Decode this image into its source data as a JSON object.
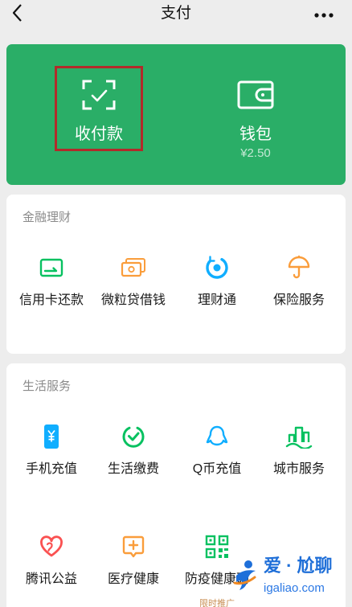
{
  "header": {
    "title": "支付",
    "back_icon": "chevron-left-icon",
    "more_icon": "more-dots-icon"
  },
  "theme": {
    "page_bg": "#ededed",
    "hero_green": "#2aae67",
    "highlight_red": "#b22a2a"
  },
  "hero": {
    "pay": {
      "label": "收付款",
      "icon": "scan-pay-icon"
    },
    "wallet": {
      "label": "钱包",
      "balance": "¥2.50",
      "icon": "wallet-icon"
    }
  },
  "finance": {
    "title": "金融理财",
    "items": [
      {
        "label": "信用卡还款",
        "icon": "credit-card-repay-icon",
        "color": "#07c160"
      },
      {
        "label": "微粒贷借钱",
        "icon": "loan-banknote-icon",
        "color": "#fa9d3b"
      },
      {
        "label": "理财通",
        "icon": "wealth-management-icon",
        "color": "#10aeff"
      },
      {
        "label": "保险服务",
        "icon": "insurance-umbrella-icon",
        "color": "#fa9d3b"
      }
    ]
  },
  "life": {
    "title": "生活服务",
    "items": [
      {
        "label": "手机充值",
        "icon": "mobile-topup-icon",
        "color": "#10aeff"
      },
      {
        "label": "生活缴费",
        "icon": "utility-payment-icon",
        "color": "#07c160"
      },
      {
        "label": "Q币充值",
        "icon": "qq-penguin-icon",
        "color": "#10aeff"
      },
      {
        "label": "城市服务",
        "icon": "city-buildings-icon",
        "color": "#07c160"
      },
      {
        "label": "腾讯公益",
        "icon": "charity-heart-icon",
        "color": "#fa5151"
      },
      {
        "label": "医疗健康",
        "icon": "medical-plus-icon",
        "color": "#fa9d3b"
      },
      {
        "label": "防疫健康码",
        "icon": "health-qr-code-icon",
        "color": "#07c160",
        "tag": "限时推广"
      }
    ]
  },
  "watermark": {
    "brand": "爱 · 尬聊",
    "domain": "igaliao.com"
  }
}
